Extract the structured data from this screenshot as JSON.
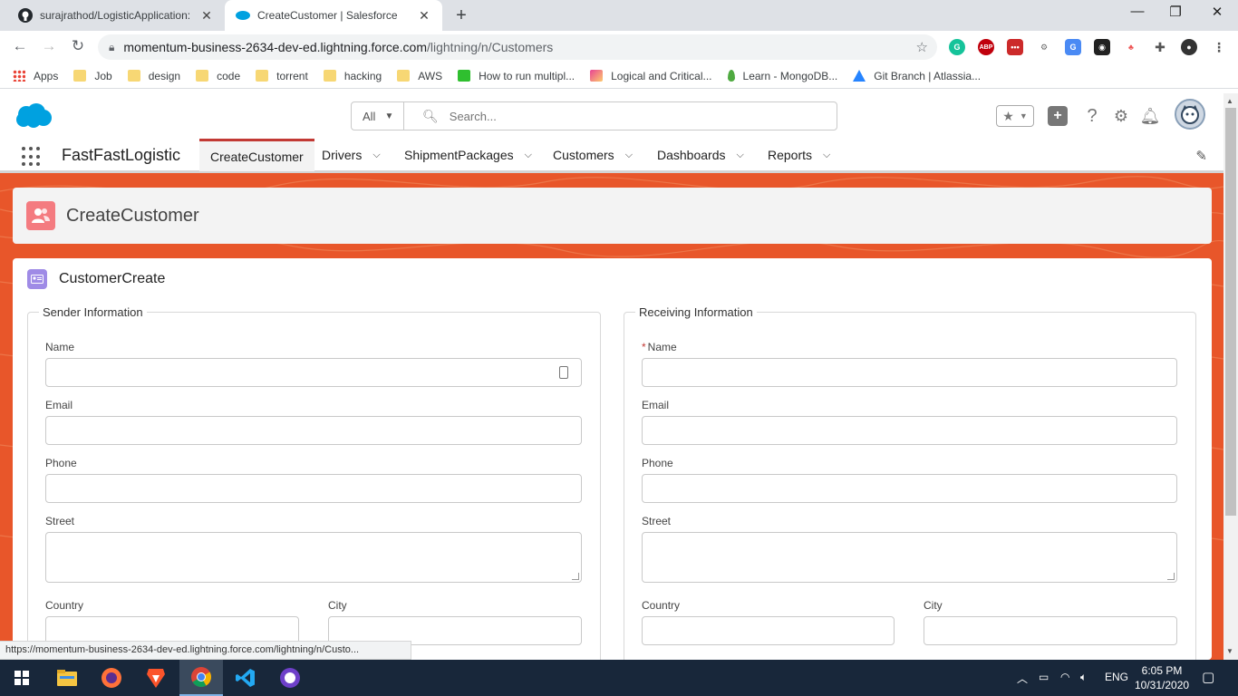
{
  "browser": {
    "tabs": [
      {
        "title": "surajrathod/LogisticApplication: ",
        "favicon": "github-icon",
        "close": "✕"
      },
      {
        "title": "CreateCustomer | Salesforce",
        "favicon": "salesforce-cloud-icon",
        "close": "✕"
      }
    ],
    "new_tab": "+",
    "url_host": "momentum-business-2634-dev-ed.lightning.force.com",
    "url_path": "/lightning/n/Customers",
    "bookmarks": [
      {
        "label": "Apps",
        "icon": "apps-grid-icon"
      },
      {
        "label": "Job",
        "icon": "folder-icon"
      },
      {
        "label": "design",
        "icon": "folder-icon"
      },
      {
        "label": "code",
        "icon": "folder-icon"
      },
      {
        "label": "torrent",
        "icon": "folder-icon"
      },
      {
        "label": "hacking",
        "icon": "folder-icon"
      },
      {
        "label": "AWS",
        "icon": "folder-icon"
      },
      {
        "label": "How to run multipl...",
        "icon": "power-icon"
      },
      {
        "label": "Logical and Critical...",
        "icon": "image-icon"
      },
      {
        "label": "Learn - MongoDB...",
        "icon": "mongodb-leaf-icon"
      },
      {
        "label": "Git Branch | Atlassia...",
        "icon": "atlassian-icon"
      }
    ],
    "status_url": "https://momentum-business-2634-dev-ed.lightning.force.com/lightning/n/Custo..."
  },
  "salesforce": {
    "search": {
      "scope": "All",
      "placeholder": "Search..."
    },
    "app_name": "FastFastLogistic",
    "nav": [
      {
        "label": "CreateCustomer",
        "active": true,
        "dropdown": false
      },
      {
        "label": "Drivers",
        "active": false,
        "dropdown": true
      },
      {
        "label": "ShipmentPackages",
        "active": false,
        "dropdown": true
      },
      {
        "label": "Customers",
        "active": false,
        "dropdown": true
      },
      {
        "label": "Dashboards",
        "active": false,
        "dropdown": true
      },
      {
        "label": "Reports",
        "active": false,
        "dropdown": true
      }
    ],
    "page_title": "CreateCustomer",
    "card_title": "CustomerCreate",
    "sender": {
      "legend": "Sender Information",
      "name_label": "Name",
      "email_label": "Email",
      "phone_label": "Phone",
      "street_label": "Street",
      "country_label": "Country",
      "city_label": "City"
    },
    "receiver": {
      "legend": "Receiving Information",
      "required_mark": "*",
      "name_label": "Name",
      "email_label": "Email",
      "phone_label": "Phone",
      "street_label": "Street",
      "country_label": "Country",
      "city_label": "City"
    }
  },
  "taskbar": {
    "language": "ENG",
    "time": "6:05 PM",
    "date": "10/31/2020"
  },
  "colors": {
    "banner": "#e8562a",
    "active_nav_border": "#c23934",
    "page_icon": "#f47b80",
    "card_icon": "#9f8be6",
    "taskbar": "#18273a"
  }
}
